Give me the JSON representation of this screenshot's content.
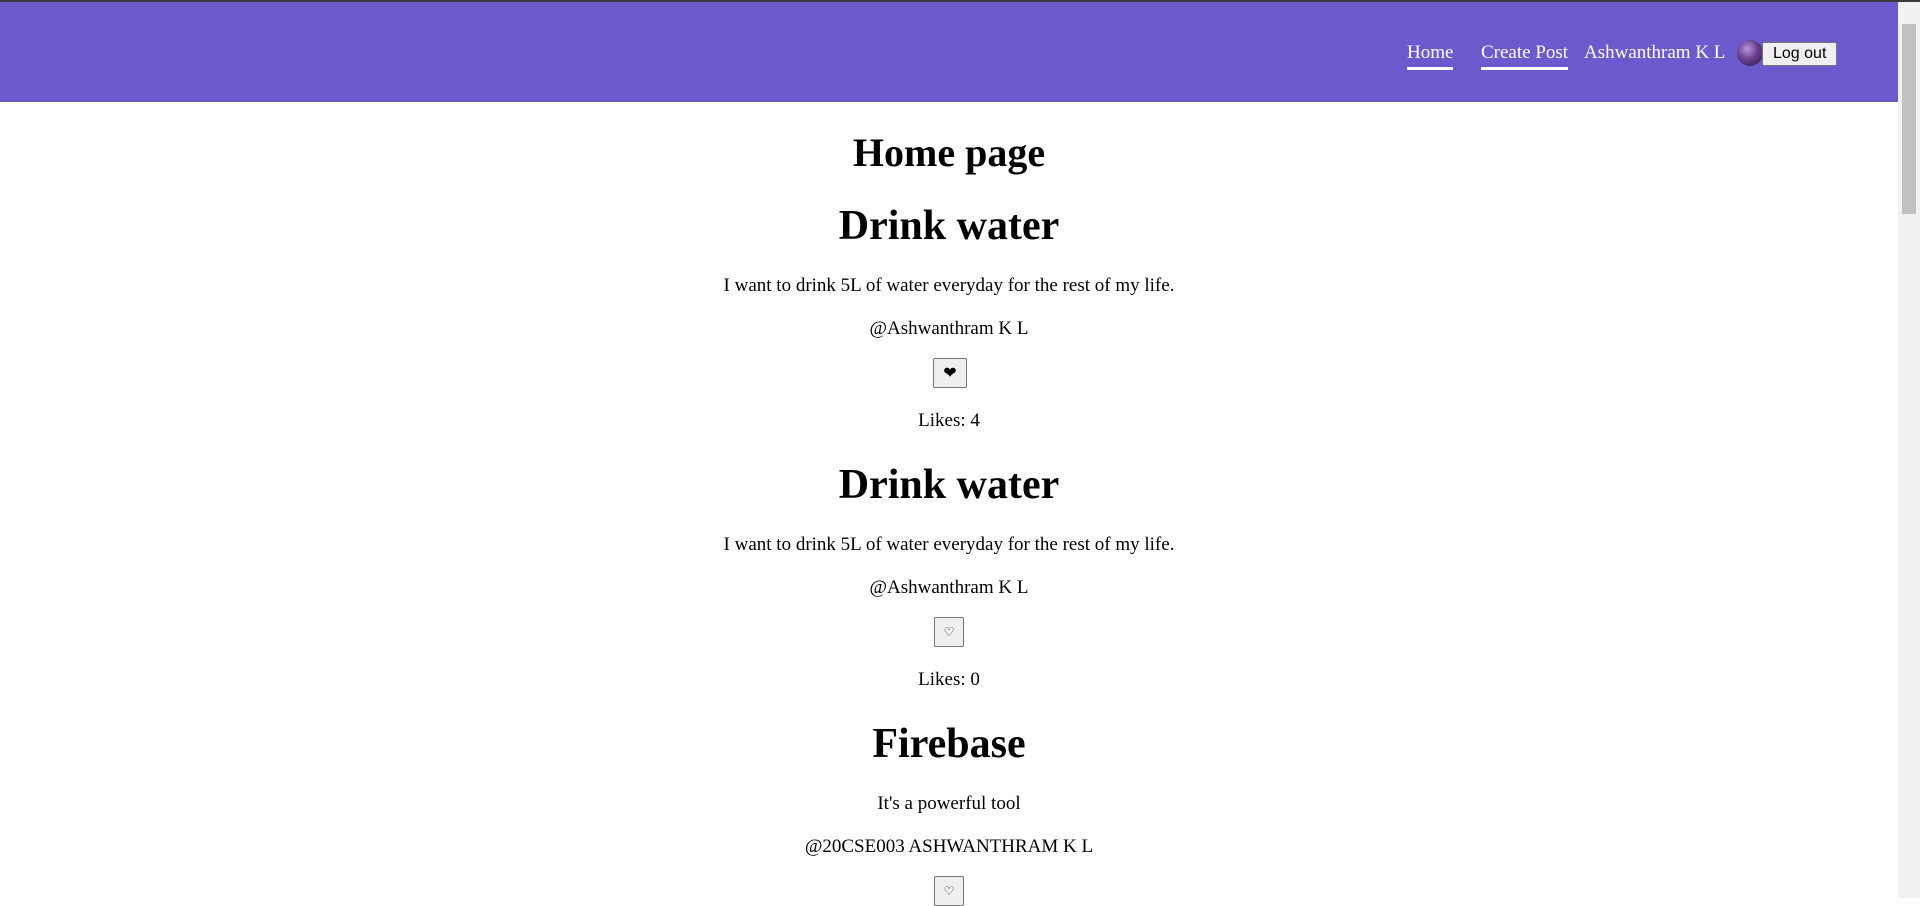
{
  "nav": {
    "home_label": "Home",
    "create_label": "Create Post",
    "user_name": "Ashwanthram K L",
    "logout_label": "Log out",
    "bar_color": "#6a5acd"
  },
  "page": {
    "title": "Home page"
  },
  "posts": [
    {
      "title": "Drink water",
      "description": "I want to drink 5L of water everyday for the rest of my life.",
      "user": "@Ashwanthram K L",
      "like_icon": "❤",
      "likes": "Likes: 4"
    },
    {
      "title": "Drink water",
      "description": "I want to drink 5L of water everyday for the rest of my life.",
      "user": "@Ashwanthram K L",
      "like_icon": "♡",
      "likes": "Likes: 0"
    },
    {
      "title": "Firebase",
      "description": "It's a powerful tool",
      "user": "@20CSE003 ASHWANTHRAM K L",
      "like_icon": "♡"
    }
  ]
}
